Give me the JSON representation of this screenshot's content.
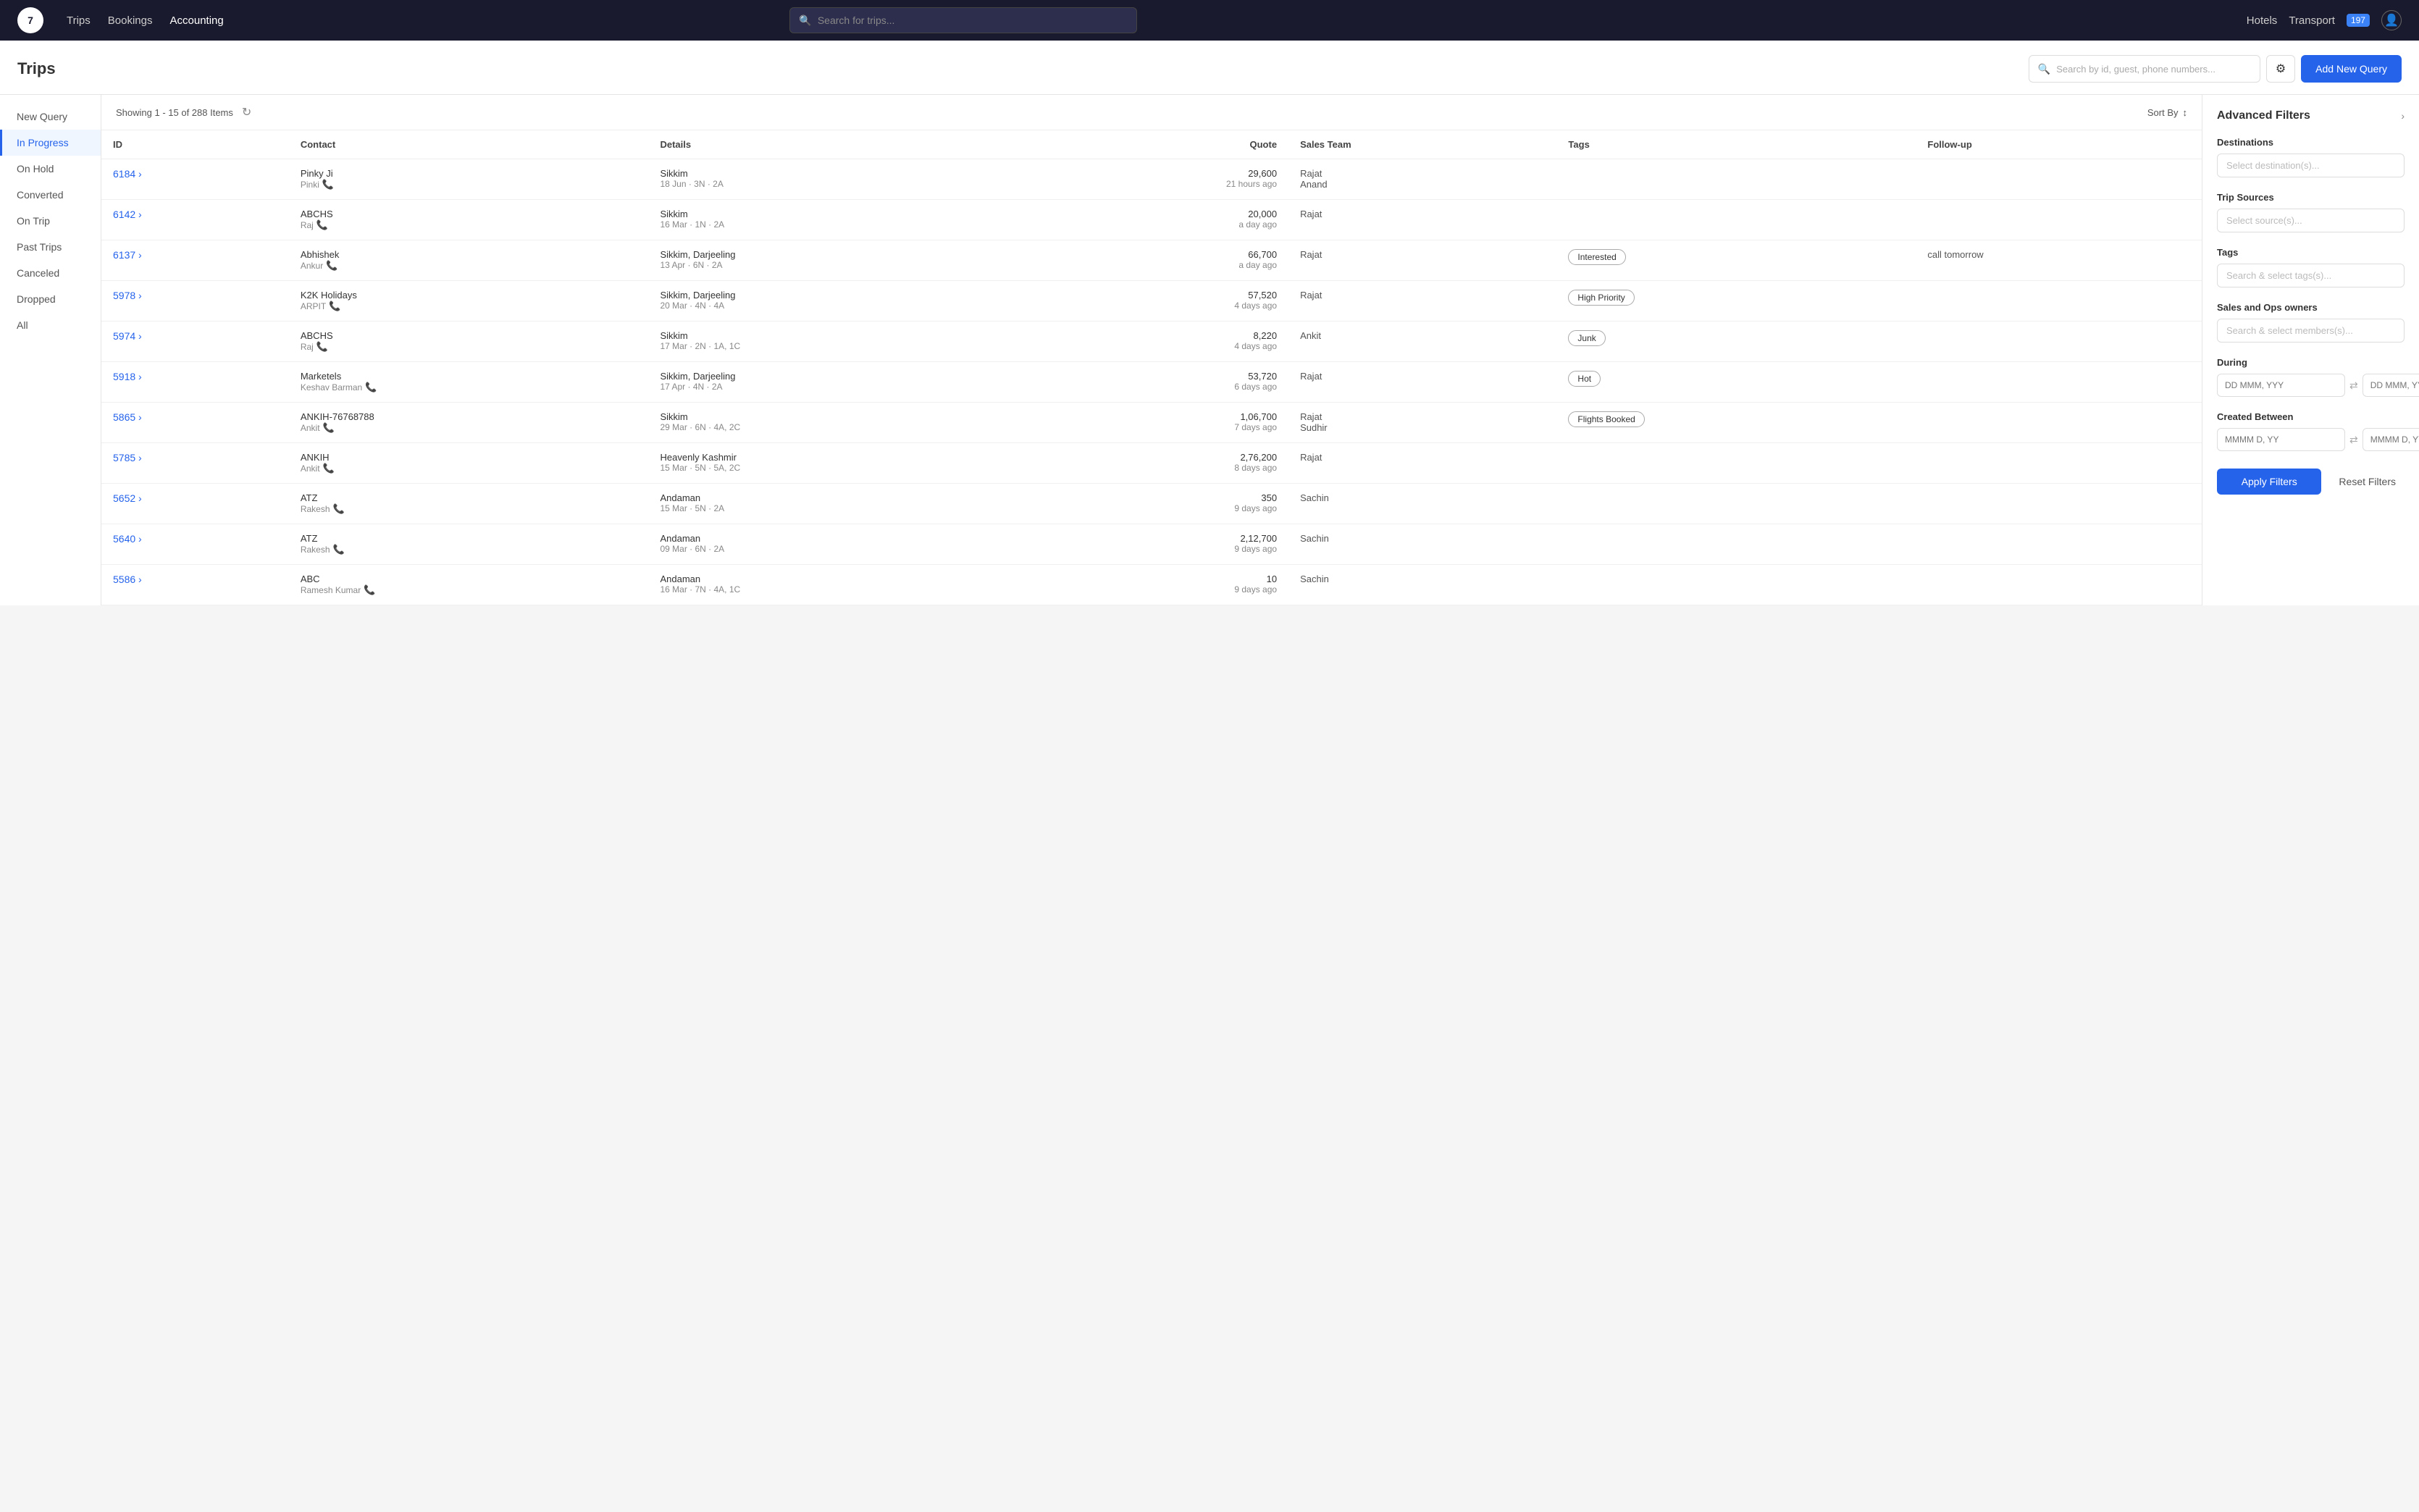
{
  "app": {
    "logo_text": "7",
    "nav_links": [
      {
        "label": "Trips",
        "active": false
      },
      {
        "label": "Bookings",
        "active": false
      },
      {
        "label": "Accounting",
        "active": true
      }
    ],
    "global_search_placeholder": "Search for trips...",
    "right_nav": {
      "hotels": "Hotels",
      "transport": "Transport",
      "badge": "197"
    }
  },
  "page": {
    "title": "Trips",
    "search_placeholder": "Search by id, guest, phone numbers...",
    "add_query_label": "Add New Query"
  },
  "sidebar": {
    "items": [
      {
        "label": "New Query",
        "active": false
      },
      {
        "label": "In Progress",
        "active": true
      },
      {
        "label": "On Hold",
        "active": false
      },
      {
        "label": "Converted",
        "active": false
      },
      {
        "label": "On Trip",
        "active": false
      },
      {
        "label": "Past Trips",
        "active": false
      },
      {
        "label": "Canceled",
        "active": false
      },
      {
        "label": "Dropped",
        "active": false
      },
      {
        "label": "All",
        "active": false
      }
    ]
  },
  "table": {
    "showing_text": "Showing 1 - 15 of 288 Items",
    "sort_by_label": "Sort By",
    "columns": [
      "ID",
      "Contact",
      "Details",
      "Quote",
      "Sales Team",
      "Tags",
      "Follow-up"
    ],
    "rows": [
      {
        "id": "6184",
        "contact_name": "Pinky Ji",
        "contact_sub": "Pinki",
        "details_dest": "Sikkim",
        "details_sub": "18 Jun · 3N · 2A",
        "quote_amount": "29,600",
        "quote_time": "21 hours ago",
        "sales_team": "Rajat\nAnand",
        "sales_team_line1": "Rajat",
        "sales_team_line2": "Anand",
        "tag": "",
        "follow_up": ""
      },
      {
        "id": "6142",
        "contact_name": "ABCHS",
        "contact_sub": "Raj",
        "details_dest": "Sikkim",
        "details_sub": "16 Mar · 1N · 2A",
        "quote_amount": "20,000",
        "quote_time": "a day ago",
        "sales_team_line1": "Rajat",
        "sales_team_line2": "",
        "tag": "",
        "follow_up": ""
      },
      {
        "id": "6137",
        "contact_name": "Abhishek",
        "contact_sub": "Ankur",
        "details_dest": "Sikkim, Darjeeling",
        "details_sub": "13 Apr · 6N · 2A",
        "quote_amount": "66,700",
        "quote_time": "a day ago",
        "sales_team_line1": "Rajat",
        "sales_team_line2": "",
        "tag": "Interested",
        "tag_class": "interested",
        "follow_up": "call tomorrow"
      },
      {
        "id": "5978",
        "contact_name": "K2K Holidays",
        "contact_sub": "ARPIT",
        "details_dest": "Sikkim, Darjeeling",
        "details_sub": "20 Mar · 4N · 4A",
        "quote_amount": "57,520",
        "quote_time": "4 days ago",
        "sales_team_line1": "Rajat",
        "sales_team_line2": "",
        "tag": "High Priority",
        "tag_class": "high-priority",
        "follow_up": ""
      },
      {
        "id": "5974",
        "contact_name": "ABCHS",
        "contact_sub": "Raj",
        "details_dest": "Sikkim",
        "details_sub": "17 Mar · 2N · 1A, 1C",
        "quote_amount": "8,220",
        "quote_time": "4 days ago",
        "sales_team_line1": "Ankit",
        "sales_team_line2": "",
        "tag": "Junk",
        "tag_class": "junk",
        "follow_up": ""
      },
      {
        "id": "5918",
        "contact_name": "Marketels",
        "contact_sub": "Keshav Barman",
        "details_dest": "Sikkim, Darjeeling",
        "details_sub": "17 Apr · 4N · 2A",
        "quote_amount": "53,720",
        "quote_time": "6 days ago",
        "sales_team_line1": "Rajat",
        "sales_team_line2": "",
        "tag": "Hot",
        "tag_class": "hot",
        "follow_up": ""
      },
      {
        "id": "5865",
        "contact_name": "ANKIH-76768788",
        "contact_sub": "Ankit",
        "details_dest": "Sikkim",
        "details_sub": "29 Mar · 6N · 4A, 2C",
        "quote_amount": "1,06,700",
        "quote_time": "7 days ago",
        "sales_team_line1": "Rajat",
        "sales_team_line2": "Sudhir",
        "tag": "Flights Booked",
        "tag_class": "flights-booked",
        "follow_up": ""
      },
      {
        "id": "5785",
        "contact_name": "ANKIH",
        "contact_sub": "Ankit",
        "details_dest": "Heavenly Kashmir",
        "details_sub": "15 Mar · 5N · 5A, 2C",
        "quote_amount": "2,76,200",
        "quote_time": "8 days ago",
        "sales_team_line1": "Rajat",
        "sales_team_line2": "",
        "tag": "",
        "follow_up": ""
      },
      {
        "id": "5652",
        "contact_name": "ATZ",
        "contact_sub": "Rakesh",
        "details_dest": "Andaman",
        "details_sub": "15 Mar · 5N · 2A",
        "quote_amount": "350",
        "quote_time": "9 days ago",
        "sales_team_line1": "Sachin",
        "sales_team_line2": "",
        "tag": "",
        "follow_up": ""
      },
      {
        "id": "5640",
        "contact_name": "ATZ",
        "contact_sub": "Rakesh",
        "details_dest": "Andaman",
        "details_sub": "09 Mar · 6N · 2A",
        "quote_amount": "2,12,700",
        "quote_time": "9 days ago",
        "sales_team_line1": "Sachin",
        "sales_team_line2": "",
        "tag": "",
        "follow_up": ""
      },
      {
        "id": "5586",
        "contact_name": "ABC",
        "contact_sub": "Ramesh Kumar",
        "details_dest": "Andaman",
        "details_sub": "16 Mar · 7N · 4A, 1C",
        "quote_amount": "10",
        "quote_time": "9 days ago",
        "sales_team_line1": "Sachin",
        "sales_team_line2": "",
        "tag": "",
        "follow_up": ""
      }
    ]
  },
  "filters": {
    "panel_title": "Advanced Filters",
    "destinations_label": "Destinations",
    "destinations_placeholder": "Select destination(s)...",
    "trip_sources_label": "Trip Sources",
    "trip_sources_placeholder": "Select source(s)...",
    "tags_label": "Tags",
    "tags_placeholder": "Search & select tags(s)...",
    "sales_ops_label": "Sales and Ops owners",
    "sales_ops_placeholder": "Search & select members(s)...",
    "during_label": "During",
    "during_from_placeholder": "DD MMM, YYY",
    "during_to_placeholder": "DD MMM, YYY",
    "created_between_label": "Created Between",
    "created_from_placeholder": "MMMM D, YY",
    "created_to_placeholder": "MMMM D, YY",
    "apply_label": "Apply Filters",
    "reset_label": "Reset Filters"
  }
}
